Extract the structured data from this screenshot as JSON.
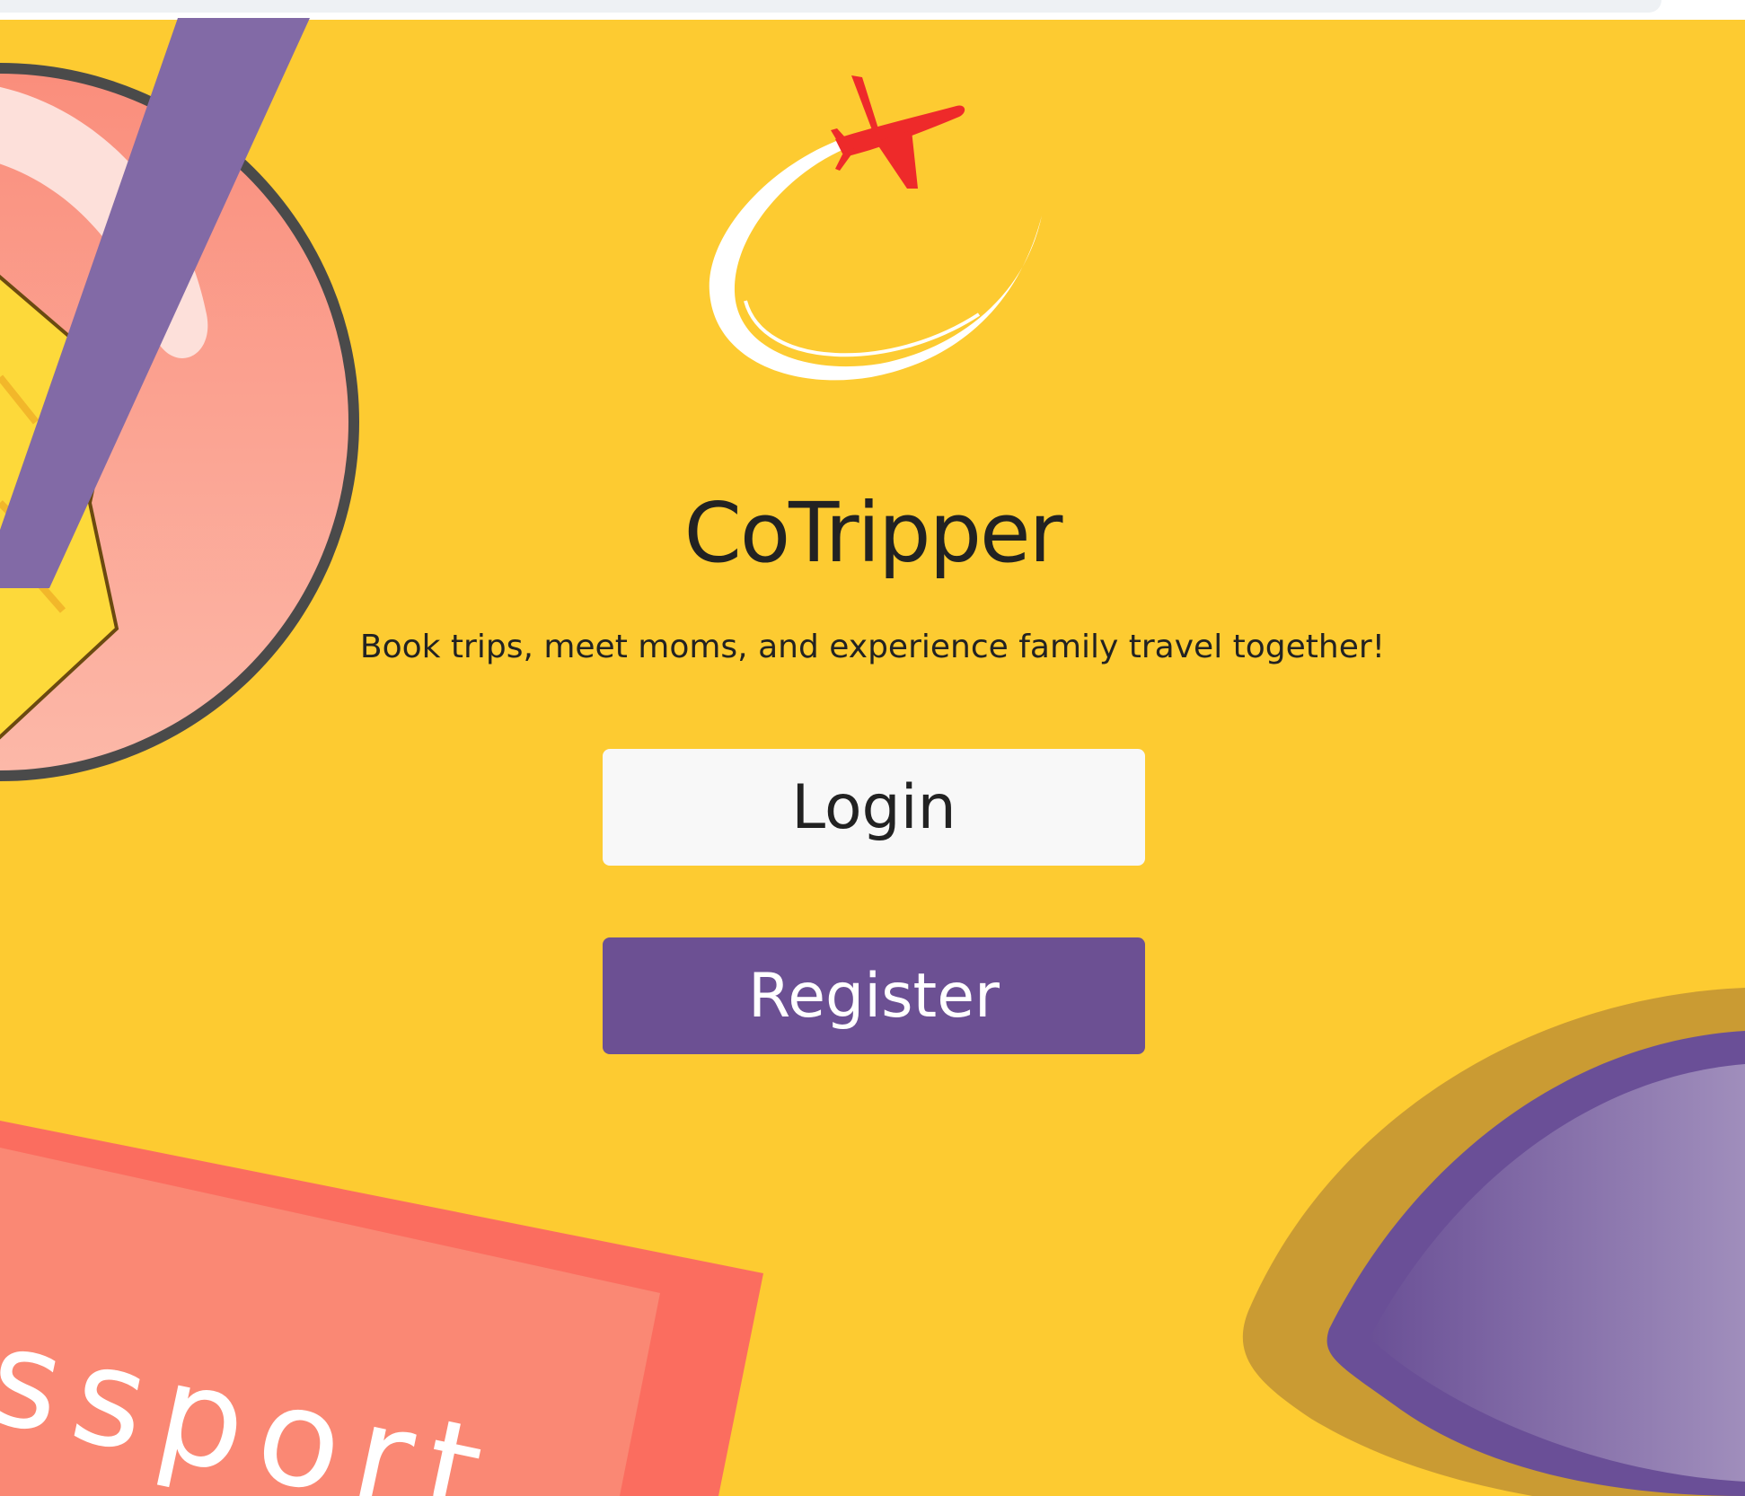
{
  "app": {
    "title": "CoTripper",
    "tagline": "Book trips, meet moms, and experience family travel together!"
  },
  "buttons": {
    "login_label": "Login",
    "register_label": "Register"
  },
  "decor": {
    "passport_text": "ssport"
  },
  "icons": {
    "logo": "airplane-swoosh-icon"
  },
  "colors": {
    "background": "#fdcb31",
    "register_button": "#6c5093",
    "login_button": "#f8f8f8",
    "text": "#222222",
    "plane": "#ee2a2a"
  }
}
